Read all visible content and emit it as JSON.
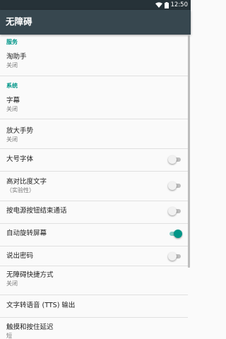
{
  "status_bar": {
    "time": "12:50",
    "wifi_icon": "wifi-icon",
    "battery_icon": "battery-icon"
  },
  "app_bar": {
    "title": "无障碍"
  },
  "categories": {
    "services": "服务",
    "system": "系统"
  },
  "items": {
    "taozhushou": {
      "title": "淘助手",
      "summary": "关闭"
    },
    "captions": {
      "title": "字幕",
      "summary": "关闭"
    },
    "magnification": {
      "title": "放大手势",
      "summary": "关闭"
    },
    "large_text": {
      "title": "大号字体",
      "enabled": false
    },
    "high_contrast": {
      "title": "高对比度文字",
      "summary": "（实验性）",
      "enabled": false
    },
    "power_ends_call": {
      "title": "按电源按钮结束通话",
      "enabled": false
    },
    "auto_rotate": {
      "title": "自动旋转屏幕",
      "enabled": true
    },
    "speak_passwords": {
      "title": "说出密码",
      "enabled": false
    },
    "shortcut": {
      "title": "无障碍快捷方式",
      "summary": "关闭"
    },
    "tts": {
      "title": "文字转语音 (TTS) 输出"
    },
    "touch_hold_delay": {
      "title": "触摸和按住延迟",
      "summary": "短"
    }
  }
}
